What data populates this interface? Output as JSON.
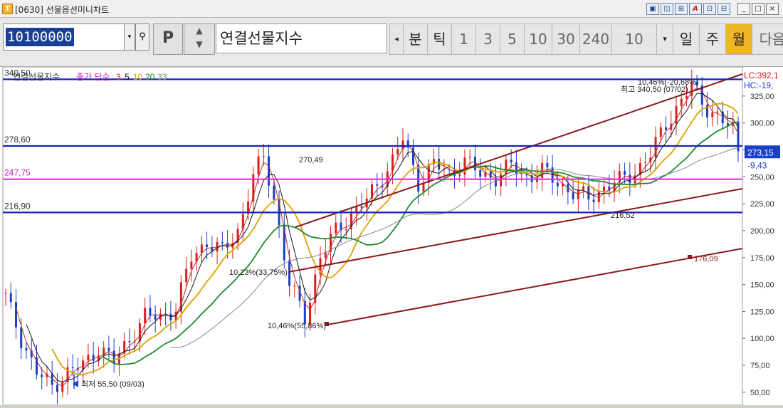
{
  "window": {
    "title": "[0630] 선물옵션미니차트",
    "icon_label": "T",
    "buttons": [
      "▣",
      "◫",
      "⊞",
      "A",
      "⊡",
      "⊟"
    ],
    "controls": [
      "_",
      "□",
      "×"
    ]
  },
  "toolbar": {
    "code_value": "10100000",
    "p_label": "P",
    "name": "연결선물지수",
    "left_arrow": "◂",
    "period_items": [
      "분",
      "틱",
      "1",
      "3",
      "5",
      "10",
      "30",
      "240",
      "10",
      "▾",
      "일",
      "주",
      "월",
      "다음"
    ],
    "active_period": "월"
  },
  "chart": {
    "legend": {
      "name": "연결선물지수",
      "series_label": "종가 단순",
      "periods": [
        "3",
        "5",
        "10",
        "20",
        "33"
      ],
      "period_colors": [
        "#c62a2a",
        "#1a1a1a",
        "#e0a000",
        "#1f8a2e",
        "#888888"
      ]
    },
    "hlines": [
      {
        "label": "340,50",
        "value": 340.5,
        "color": "#1a20c0"
      },
      {
        "label": "278,60",
        "value": 278.6,
        "color": "#1a20c0"
      },
      {
        "label": "247,75",
        "value": 247.75,
        "color": "#e62ee6"
      },
      {
        "label": "216,90",
        "value": 216.9,
        "color": "#1a20c0"
      }
    ],
    "y_ticks": [
      "325,00",
      "300,00",
      "275,00",
      "250,00",
      "225,00",
      "200,00",
      "175,00",
      "150,00",
      "125,00",
      "100,00",
      "75,00",
      "50,00"
    ],
    "y_range": [
      38,
      352
    ],
    "lc_label": "LC:392,1",
    "hc_label": "HC:-19,",
    "current_price": "273,15",
    "change": "-9,43",
    "annotations": {
      "high": "최고 340,50 (07/02)",
      "high_pct": "10,46%(-20,68%)",
      "low": "최저 55,50 (09/03)",
      "peak1": "270,49",
      "low2": "216,52",
      "ann1": "10,23%(33,75%)",
      "ann2": "10,46%(55,86%)",
      "ann3": "176,09"
    }
  }
}
